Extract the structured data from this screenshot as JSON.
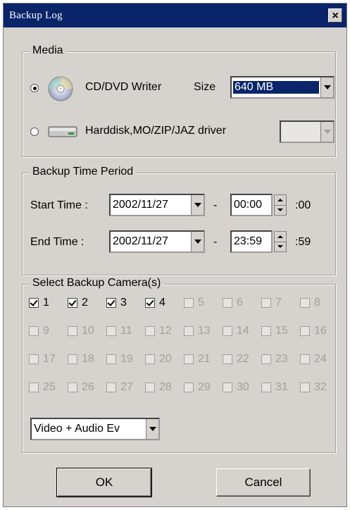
{
  "window": {
    "title": "Backup Log",
    "close_glyph": "×"
  },
  "media": {
    "legend": "Media",
    "cd": {
      "label": "CD/DVD Writer",
      "selected": true,
      "size_label": "Size",
      "size_value": "640 MB",
      "icon": "cd-icon"
    },
    "hdd": {
      "label": "Harddisk,MO/ZIP/JAZ driver",
      "selected": false,
      "icon": "harddisk-icon",
      "combo_value": ""
    }
  },
  "period": {
    "legend": "Backup Time Period",
    "start": {
      "label": "Start Time :",
      "date": "2002/11/27",
      "dash": "-",
      "time": "00:00",
      "seconds": ":00"
    },
    "end": {
      "label": "End Time :",
      "date": "2002/11/27",
      "dash": "-",
      "time": "23:59",
      "seconds": ":59"
    }
  },
  "cameras": {
    "legend": "Select Backup Camera(s)",
    "items": [
      {
        "n": "1",
        "checked": true,
        "enabled": true
      },
      {
        "n": "2",
        "checked": true,
        "enabled": true
      },
      {
        "n": "3",
        "checked": true,
        "enabled": true
      },
      {
        "n": "4",
        "checked": true,
        "enabled": true
      },
      {
        "n": "5",
        "checked": false,
        "enabled": false
      },
      {
        "n": "6",
        "checked": false,
        "enabled": false
      },
      {
        "n": "7",
        "checked": false,
        "enabled": false
      },
      {
        "n": "8",
        "checked": false,
        "enabled": false
      },
      {
        "n": "9",
        "checked": false,
        "enabled": false
      },
      {
        "n": "10",
        "checked": false,
        "enabled": false
      },
      {
        "n": "11",
        "checked": false,
        "enabled": false
      },
      {
        "n": "12",
        "checked": false,
        "enabled": false
      },
      {
        "n": "13",
        "checked": false,
        "enabled": false
      },
      {
        "n": "14",
        "checked": false,
        "enabled": false
      },
      {
        "n": "15",
        "checked": false,
        "enabled": false
      },
      {
        "n": "16",
        "checked": false,
        "enabled": false
      },
      {
        "n": "17",
        "checked": false,
        "enabled": false
      },
      {
        "n": "18",
        "checked": false,
        "enabled": false
      },
      {
        "n": "19",
        "checked": false,
        "enabled": false
      },
      {
        "n": "20",
        "checked": false,
        "enabled": false
      },
      {
        "n": "21",
        "checked": false,
        "enabled": false
      },
      {
        "n": "22",
        "checked": false,
        "enabled": false
      },
      {
        "n": "23",
        "checked": false,
        "enabled": false
      },
      {
        "n": "24",
        "checked": false,
        "enabled": false
      },
      {
        "n": "25",
        "checked": false,
        "enabled": false
      },
      {
        "n": "26",
        "checked": false,
        "enabled": false
      },
      {
        "n": "27",
        "checked": false,
        "enabled": false
      },
      {
        "n": "28",
        "checked": false,
        "enabled": false
      },
      {
        "n": "29",
        "checked": false,
        "enabled": false
      },
      {
        "n": "30",
        "checked": false,
        "enabled": false
      },
      {
        "n": "31",
        "checked": false,
        "enabled": false
      },
      {
        "n": "32",
        "checked": false,
        "enabled": false
      }
    ],
    "event_type": "Video + Audio Ev"
  },
  "buttons": {
    "ok": "OK",
    "cancel": "Cancel"
  }
}
